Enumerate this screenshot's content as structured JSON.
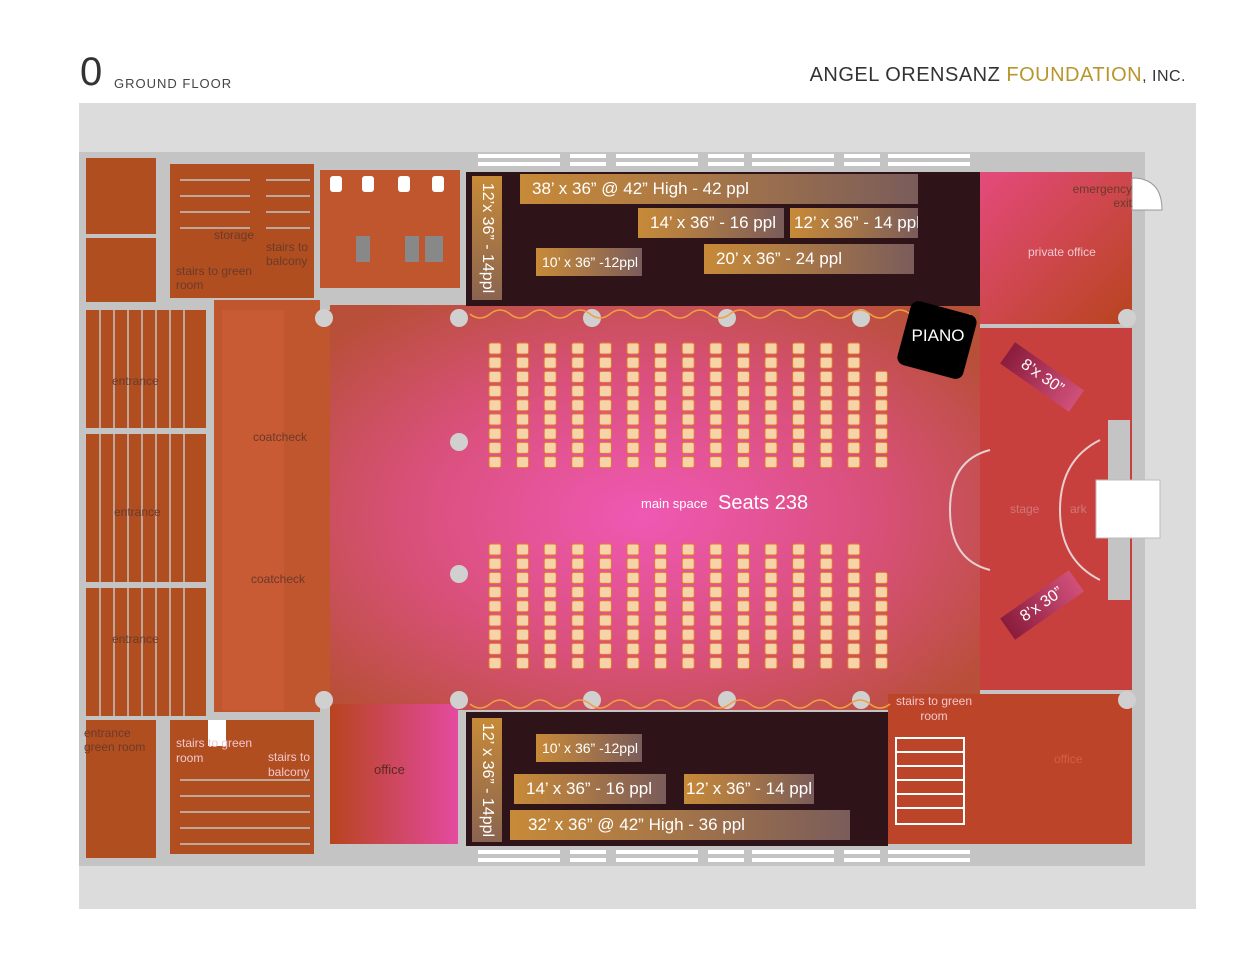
{
  "header": {
    "floor_number": "0",
    "floor_name": "GROUND FLOOR",
    "org_part1": "ANGEL ORENSANZ ",
    "org_part2": "FOUNDATION",
    "org_part3": ", INC."
  },
  "colors": {
    "background_panel": "#dcdcdc",
    "walls": "#c4c4c4",
    "room_fill": "#b04e20",
    "main_space_center": "#f058b4",
    "table_area_dark": "#2e1418",
    "table_gold": "#c78a38",
    "seat_fill": "#f6d3a8",
    "seat_stroke": "#e47a2a",
    "piano": "#000000"
  },
  "rooms": {
    "storage": "storage",
    "stairs_to_balcony_top": "stairs to balcony",
    "stairs_to_green_room_top": "stairs to green room",
    "entrance_1": "entrance",
    "entrance_2": "entrance",
    "entrance_3": "entrance",
    "coatcheck_1": "coatcheck",
    "coatcheck_2": "coatcheck",
    "entrance_green_room": "entrance green room",
    "stairs_to_green_room_bottom": "stairs to green room",
    "stairs_to_balcony_bottom": "stairs to balcony",
    "office_left": "office",
    "emergency_exit": "emergency exit",
    "private_office": "private office",
    "stage": "stage",
    "ark": "ark",
    "stairs_to_green_room_right": "stairs to green room",
    "office_right": "office"
  },
  "main_space": {
    "label": "main space",
    "seats": "Seats 238"
  },
  "piano": "PIANO",
  "stage_platforms": [
    "8’x 30”",
    "8’x 30”"
  ],
  "tables_top": {
    "vertical": "12’x 36” - 14ppl",
    "t1": "38’ x 36” @ 42” High - 42 ppl",
    "t2": "14’ x 36” - 16 ppl",
    "t3": "12’ x 36” - 14 ppl",
    "t4": "10’ x 36” -12ppl",
    "t5": "20’ x 36” - 24 ppl"
  },
  "tables_bottom": {
    "vertical": "12’ x 36” - 14ppl",
    "t1": "10’ x 36” -12ppl",
    "t2": "14’ x 36” - 16 ppl",
    "t3": "12’ x 36” - 14 ppl",
    "t4": "32’ x 36” @ 42” High - 36 ppl"
  }
}
